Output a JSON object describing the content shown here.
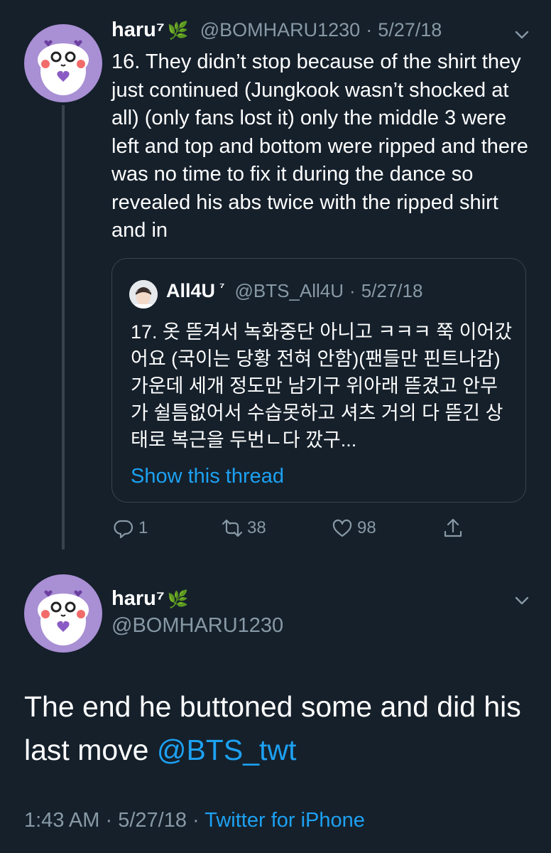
{
  "tweet1": {
    "name": "haru⁷",
    "handle": "@BOMHARU1230",
    "sep": "·",
    "date": "5/27/18",
    "text": "16. They didn’t stop because of the shirt they just continued (Jungkook wasn’t shocked at all) (only fans lost it) only the middle 3 were left and top and bottom were ripped and there was no time to fix it during the dance so revealed his abs twice with the ripped shirt and in",
    "quote": {
      "name": "All4U",
      "sup": "⁷",
      "handle": "@BTS_All4U",
      "sep": "·",
      "date": "5/27/18",
      "text": "17. 옷 뜯겨서 녹화중단 아니고 ㅋㅋㅋ 쭉 이어갔어요 (국이는 당황 전혀 안함)(팬들만 핀트나감) 가운데 세개 정도만 남기구 위아래 뜯겼고 안무가 쉴틈없어서 수습못하고 셔츠 거의 다 뜯긴 상태로 복근을 두번ㄴ다 깠구...",
      "link": "Show this thread"
    },
    "actions": {
      "replies": "1",
      "retweets": "38",
      "likes": "98"
    }
  },
  "tweet2": {
    "name": "haru⁷",
    "handle": "@BOMHARU1230",
    "text": "The end he buttoned some and did his last move ",
    "mention": "@BTS_twt",
    "time": "1:43 AM",
    "sep1": "·",
    "date": "5/27/18",
    "sep2": "·",
    "source": "Twitter for iPhone"
  },
  "icons": {
    "leaf": "herb-icon",
    "reply": "reply-icon",
    "retweet": "retweet-icon",
    "like": "heart-icon",
    "share": "share-icon",
    "chevron": "chevron-down-icon"
  },
  "colors": {
    "background": "#15202b",
    "text": "#ffffff",
    "secondary": "#8899a6",
    "link": "#1da1f2",
    "border": "#38444d",
    "avatar": "#a98fd4"
  }
}
